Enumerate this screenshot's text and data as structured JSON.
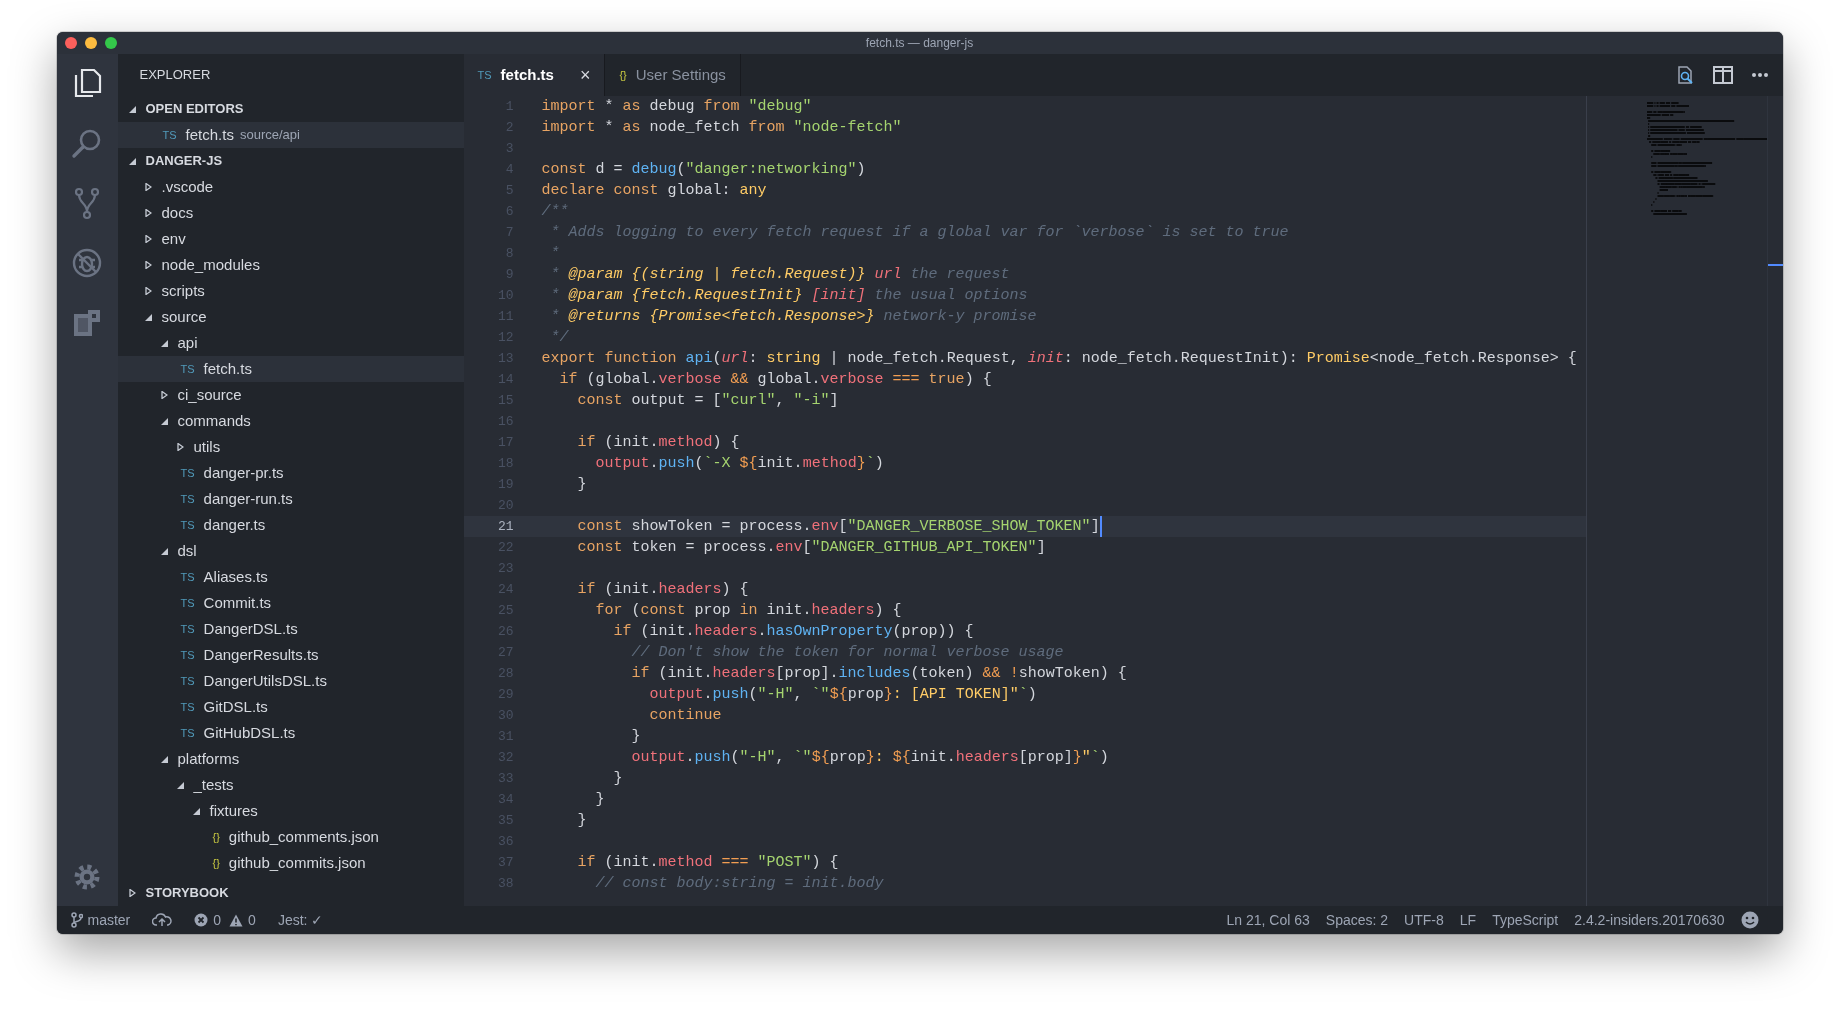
{
  "window": {
    "title": "fetch.ts — danger-js"
  },
  "activity_bar": {
    "items": [
      {
        "kind": "files",
        "selected": true
      },
      {
        "kind": "search",
        "selected": false
      },
      {
        "kind": "git",
        "selected": false
      },
      {
        "kind": "debug",
        "selected": false
      },
      {
        "kind": "extensions",
        "selected": false
      }
    ],
    "bottom": [
      {
        "kind": "settings",
        "selected": false
      }
    ]
  },
  "sidebar": {
    "title": "EXPLORER",
    "sections": [
      {
        "title": "OPEN EDITORS",
        "expanded": true,
        "items": [
          {
            "label": "fetch.ts",
            "path": "source/api",
            "kind": "ts",
            "badge": "TS",
            "selected": true
          }
        ]
      },
      {
        "title": "DANGER-JS",
        "expanded": true,
        "items": [
          {
            "label": ".vscode",
            "kind": "folder",
            "expanded": false,
            "selected": false
          },
          {
            "label": "docs",
            "kind": "folder",
            "expanded": false,
            "selected": false
          },
          {
            "label": "env",
            "kind": "folder",
            "expanded": false,
            "selected": false
          },
          {
            "label": "node_modules",
            "kind": "folder",
            "expanded": false,
            "selected": false
          },
          {
            "label": "scripts",
            "kind": "folder",
            "expanded": false,
            "selected": false
          },
          {
            "label": "source",
            "kind": "folder",
            "expanded": true,
            "selected": false,
            "children": [
              {
                "label": "api",
                "kind": "folder",
                "expanded": true,
                "selected": false,
                "children": [
                  {
                    "label": "fetch.ts",
                    "kind": "ts",
                    "badge": "TS",
                    "selected": true
                  }
                ]
              },
              {
                "label": "ci_source",
                "kind": "folder",
                "expanded": false,
                "selected": false
              },
              {
                "label": "commands",
                "kind": "folder",
                "expanded": true,
                "selected": false,
                "children": [
                  {
                    "label": "utils",
                    "kind": "folder",
                    "expanded": false,
                    "selected": false
                  },
                  {
                    "label": "danger-pr.ts",
                    "kind": "ts",
                    "badge": "TS",
                    "selected": false
                  },
                  {
                    "label": "danger-run.ts",
                    "kind": "ts",
                    "badge": "TS",
                    "selected": false
                  },
                  {
                    "label": "danger.ts",
                    "kind": "ts",
                    "badge": "TS",
                    "selected": false
                  }
                ]
              },
              {
                "label": "dsl",
                "kind": "folder",
                "expanded": true,
                "selected": false,
                "children": [
                  {
                    "label": "Aliases.ts",
                    "kind": "ts",
                    "badge": "TS",
                    "selected": false
                  },
                  {
                    "label": "Commit.ts",
                    "kind": "ts",
                    "badge": "TS",
                    "selected": false
                  },
                  {
                    "label": "DangerDSL.ts",
                    "kind": "ts",
                    "badge": "TS",
                    "selected": false
                  },
                  {
                    "label": "DangerResults.ts",
                    "kind": "ts",
                    "badge": "TS",
                    "selected": false
                  },
                  {
                    "label": "DangerUtilsDSL.ts",
                    "kind": "ts",
                    "badge": "TS",
                    "selected": false
                  },
                  {
                    "label": "GitDSL.ts",
                    "kind": "ts",
                    "badge": "TS",
                    "selected": false
                  },
                  {
                    "label": "GitHubDSL.ts",
                    "kind": "ts",
                    "badge": "TS",
                    "selected": false
                  }
                ]
              },
              {
                "label": "platforms",
                "kind": "folder",
                "expanded": true,
                "selected": false,
                "children": [
                  {
                    "label": "_tests",
                    "kind": "folder",
                    "expanded": true,
                    "selected": false,
                    "children": [
                      {
                        "label": "fixtures",
                        "kind": "folder",
                        "expanded": true,
                        "selected": false,
                        "children": [
                          {
                            "label": "github_comments.json",
                            "kind": "json",
                            "badge": "{}",
                            "selected": false
                          },
                          {
                            "label": "github_commits.json",
                            "kind": "json",
                            "badge": "{}",
                            "selected": false
                          }
                        ]
                      }
                    ]
                  }
                ]
              }
            ]
          }
        ]
      },
      {
        "title": "STORYBOOK",
        "expanded": false
      }
    ]
  },
  "editor": {
    "tabs": [
      {
        "label": "fetch.ts",
        "kind": "ts",
        "badge": "TS",
        "selected": true,
        "close": "×"
      },
      {
        "label": "User Settings",
        "kind": "json",
        "badge": "{}",
        "selected": false
      }
    ],
    "lines": [
      {
        "number": "1",
        "current": false,
        "tokens": [
          {
            "kind": "keyword",
            "text": "import"
          },
          {
            "kind": "plain",
            "text": " * "
          },
          {
            "kind": "keyword",
            "text": "as"
          },
          {
            "kind": "plain",
            "text": " debug "
          },
          {
            "kind": "keyword",
            "text": "from"
          },
          {
            "kind": "string",
            "text": " \"debug\""
          }
        ]
      },
      {
        "number": "2",
        "current": false,
        "tokens": [
          {
            "kind": "keyword",
            "text": "import"
          },
          {
            "kind": "plain",
            "text": " * "
          },
          {
            "kind": "keyword",
            "text": "as"
          },
          {
            "kind": "plain",
            "text": " node_fetch "
          },
          {
            "kind": "keyword",
            "text": "from"
          },
          {
            "kind": "string",
            "text": " \"node-fetch\""
          }
        ]
      },
      {
        "number": "3",
        "current": false
      },
      {
        "number": "4",
        "current": false,
        "tokens": [
          {
            "kind": "keyword",
            "text": "const"
          },
          {
            "kind": "plain",
            "text": " d = "
          },
          {
            "kind": "function",
            "text": "debug"
          },
          {
            "kind": "plain",
            "text": "("
          },
          {
            "kind": "string",
            "text": "\"danger:networking\""
          },
          {
            "kind": "plain",
            "text": ")"
          }
        ]
      },
      {
        "number": "5",
        "current": false,
        "tokens": [
          {
            "kind": "keyword",
            "text": "declare const"
          },
          {
            "kind": "plain",
            "text": " global: "
          },
          {
            "kind": "type",
            "text": "any"
          }
        ]
      },
      {
        "number": "6",
        "current": false,
        "tokens": [
          {
            "kind": "comment",
            "text": "/**"
          }
        ]
      },
      {
        "number": "7",
        "current": false,
        "tokens": [
          {
            "kind": "comment",
            "text": " * Adds logging to every fetch request if a global var for `verbose` is set to true"
          }
        ]
      },
      {
        "number": "8",
        "current": false,
        "tokens": [
          {
            "kind": "comment",
            "text": " *"
          }
        ]
      },
      {
        "number": "9",
        "current": false,
        "tokens": [
          {
            "kind": "comment",
            "text": " * "
          },
          {
            "kind": "doctag",
            "text": "@param {(string | fetch.Request)}"
          },
          {
            "kind": "param",
            "text": " url"
          },
          {
            "kind": "comment",
            "text": " the request"
          }
        ]
      },
      {
        "number": "10",
        "current": false,
        "tokens": [
          {
            "kind": "comment",
            "text": " * "
          },
          {
            "kind": "doctag",
            "text": "@param {fetch.RequestInit}"
          },
          {
            "kind": "param",
            "text": " [init]"
          },
          {
            "kind": "comment",
            "text": " the usual options"
          }
        ]
      },
      {
        "number": "11",
        "current": false,
        "tokens": [
          {
            "kind": "comment",
            "text": " * "
          },
          {
            "kind": "doctag",
            "text": "@returns {Promise<fetch.Response>}"
          },
          {
            "kind": "comment",
            "text": " network-y promise"
          }
        ]
      },
      {
        "number": "12",
        "current": false,
        "tokens": [
          {
            "kind": "comment",
            "text": " */"
          }
        ]
      },
      {
        "number": "13",
        "current": false,
        "tokens": [
          {
            "kind": "keyword",
            "text": "export function"
          },
          {
            "kind": "function",
            "text": " api"
          },
          {
            "kind": "plain",
            "text": "("
          },
          {
            "kind": "param",
            "text": "url"
          },
          {
            "kind": "plain",
            "text": ": "
          },
          {
            "kind": "type",
            "text": "string"
          },
          {
            "kind": "plain",
            "text": " | node_fetch.Request, "
          },
          {
            "kind": "param",
            "text": "init"
          },
          {
            "kind": "plain",
            "text": ": node_fetch.RequestInit): "
          },
          {
            "kind": "type",
            "text": "Promise"
          },
          {
            "kind": "plain",
            "text": "<node_fetch.Response> {"
          }
        ]
      },
      {
        "number": "14",
        "current": false,
        "tokens": [
          {
            "kind": "keyword",
            "text": "  if"
          },
          {
            "kind": "plain",
            "text": " (global."
          },
          {
            "kind": "property",
            "text": "verbose"
          },
          {
            "kind": "operator",
            "text": " &&"
          },
          {
            "kind": "plain",
            "text": " global."
          },
          {
            "kind": "property",
            "text": "verbose"
          },
          {
            "kind": "operator",
            "text": " ==="
          },
          {
            "kind": "keyword",
            "text": " true"
          },
          {
            "kind": "plain",
            "text": ") {"
          }
        ]
      },
      {
        "number": "15",
        "current": false,
        "tokens": [
          {
            "kind": "keyword",
            "text": "    const"
          },
          {
            "kind": "plain",
            "text": " output = ["
          },
          {
            "kind": "string",
            "text": "\"curl\""
          },
          {
            "kind": "plain",
            "text": ", "
          },
          {
            "kind": "string",
            "text": "\"-i\""
          },
          {
            "kind": "plain",
            "text": "]"
          }
        ]
      },
      {
        "number": "16",
        "current": false
      },
      {
        "number": "17",
        "current": false,
        "tokens": [
          {
            "kind": "keyword",
            "text": "    if"
          },
          {
            "kind": "plain",
            "text": " (init."
          },
          {
            "kind": "property",
            "text": "method"
          },
          {
            "kind": "plain",
            "text": ") {"
          }
        ]
      },
      {
        "number": "18",
        "current": false,
        "tokens": [
          {
            "kind": "property",
            "text": "      output"
          },
          {
            "kind": "plain",
            "text": "."
          },
          {
            "kind": "function",
            "text": "push"
          },
          {
            "kind": "plain",
            "text": "("
          },
          {
            "kind": "string",
            "text": "`-X "
          },
          {
            "kind": "operator",
            "text": "${"
          },
          {
            "kind": "plain",
            "text": "init."
          },
          {
            "kind": "property",
            "text": "method"
          },
          {
            "kind": "operator",
            "text": "}"
          },
          {
            "kind": "string",
            "text": "`"
          },
          {
            "kind": "plain",
            "text": ")"
          }
        ]
      },
      {
        "number": "19",
        "current": false,
        "tokens": [
          {
            "kind": "plain",
            "text": "    }"
          }
        ]
      },
      {
        "number": "20",
        "current": false
      },
      {
        "number": "21",
        "current": true,
        "tokens": [
          {
            "kind": "keyword",
            "text": "    const"
          },
          {
            "kind": "plain",
            "text": " showToken = process."
          },
          {
            "kind": "property",
            "text": "env"
          },
          {
            "kind": "plain",
            "text": "["
          },
          {
            "kind": "string",
            "text": "\"DANGER_VERBOSE_SHOW_TOKEN\""
          },
          {
            "kind": "plain",
            "text": "]"
          }
        ]
      },
      {
        "number": "22",
        "current": false,
        "tokens": [
          {
            "kind": "keyword",
            "text": "    const"
          },
          {
            "kind": "plain",
            "text": " token = process."
          },
          {
            "kind": "property",
            "text": "env"
          },
          {
            "kind": "plain",
            "text": "["
          },
          {
            "kind": "string",
            "text": "\"DANGER_GITHUB_API_TOKEN\""
          },
          {
            "kind": "plain",
            "text": "]"
          }
        ]
      },
      {
        "number": "23",
        "current": false
      },
      {
        "number": "24",
        "current": false,
        "tokens": [
          {
            "kind": "keyword",
            "text": "    if"
          },
          {
            "kind": "plain",
            "text": " (init."
          },
          {
            "kind": "property",
            "text": "headers"
          },
          {
            "kind": "plain",
            "text": ") {"
          }
        ]
      },
      {
        "number": "25",
        "current": false,
        "tokens": [
          {
            "kind": "keyword",
            "text": "      for"
          },
          {
            "kind": "plain",
            "text": " ("
          },
          {
            "kind": "keyword",
            "text": "const"
          },
          {
            "kind": "plain",
            "text": " prop "
          },
          {
            "kind": "keyword",
            "text": "in"
          },
          {
            "kind": "plain",
            "text": " init."
          },
          {
            "kind": "property",
            "text": "headers"
          },
          {
            "kind": "plain",
            "text": ") {"
          }
        ]
      },
      {
        "number": "26",
        "current": false,
        "tokens": [
          {
            "kind": "keyword",
            "text": "        if"
          },
          {
            "kind": "plain",
            "text": " (init."
          },
          {
            "kind": "property",
            "text": "headers"
          },
          {
            "kind": "plain",
            "text": "."
          },
          {
            "kind": "function",
            "text": "hasOwnProperty"
          },
          {
            "kind": "plain",
            "text": "(prop)) {"
          }
        ]
      },
      {
        "number": "27",
        "current": false,
        "tokens": [
          {
            "kind": "comment",
            "text": "          // Don't show the token for normal verbose usage"
          }
        ]
      },
      {
        "number": "28",
        "current": false,
        "tokens": [
          {
            "kind": "keyword",
            "text": "          if"
          },
          {
            "kind": "plain",
            "text": " (init."
          },
          {
            "kind": "property",
            "text": "headers"
          },
          {
            "kind": "plain",
            "text": "[prop]."
          },
          {
            "kind": "function",
            "text": "includes"
          },
          {
            "kind": "plain",
            "text": "(token) "
          },
          {
            "kind": "operator",
            "text": "&&"
          },
          {
            "kind": "operator",
            "text": " !"
          },
          {
            "kind": "plain",
            "text": "showToken) {"
          }
        ]
      },
      {
        "number": "29",
        "current": false,
        "tokens": [
          {
            "kind": "property",
            "text": "            output"
          },
          {
            "kind": "plain",
            "text": "."
          },
          {
            "kind": "function",
            "text": "push"
          },
          {
            "kind": "plain",
            "text": "("
          },
          {
            "kind": "string",
            "text": "\"-H\""
          },
          {
            "kind": "plain",
            "text": ", "
          },
          {
            "kind": "string",
            "text": "`\""
          },
          {
            "kind": "operator",
            "text": "${"
          },
          {
            "kind": "plain",
            "text": "prop"
          },
          {
            "kind": "operator",
            "text": "}"
          },
          {
            "kind": "type",
            "text": ": [API TOKEN]\""
          },
          {
            "kind": "string",
            "text": "`"
          },
          {
            "kind": "plain",
            "text": ")"
          }
        ]
      },
      {
        "number": "30",
        "current": false,
        "tokens": [
          {
            "kind": "keyword",
            "text": "            continue"
          }
        ]
      },
      {
        "number": "31",
        "current": false,
        "tokens": [
          {
            "kind": "plain",
            "text": "          }"
          }
        ]
      },
      {
        "number": "32",
        "current": false,
        "tokens": [
          {
            "kind": "property",
            "text": "          output"
          },
          {
            "kind": "plain",
            "text": "."
          },
          {
            "kind": "function",
            "text": "push"
          },
          {
            "kind": "plain",
            "text": "("
          },
          {
            "kind": "string",
            "text": "\"-H\""
          },
          {
            "kind": "plain",
            "text": ", "
          },
          {
            "kind": "string",
            "text": "`\""
          },
          {
            "kind": "operator",
            "text": "${"
          },
          {
            "kind": "plain",
            "text": "prop"
          },
          {
            "kind": "operator",
            "text": "}"
          },
          {
            "kind": "type",
            "text": ": "
          },
          {
            "kind": "operator",
            "text": "${"
          },
          {
            "kind": "plain",
            "text": "init."
          },
          {
            "kind": "property",
            "text": "headers"
          },
          {
            "kind": "plain",
            "text": "[prop]"
          },
          {
            "kind": "operator",
            "text": "}"
          },
          {
            "kind": "type",
            "text": "\""
          },
          {
            "kind": "string",
            "text": "`"
          },
          {
            "kind": "plain",
            "text": ")"
          }
        ]
      },
      {
        "number": "33",
        "current": false,
        "tokens": [
          {
            "kind": "plain",
            "text": "        }"
          }
        ]
      },
      {
        "number": "34",
        "current": false,
        "tokens": [
          {
            "kind": "plain",
            "text": "      }"
          }
        ]
      },
      {
        "number": "35",
        "current": false,
        "tokens": [
          {
            "kind": "plain",
            "text": "    }"
          }
        ]
      },
      {
        "number": "36",
        "current": false
      },
      {
        "number": "37",
        "current": false,
        "tokens": [
          {
            "kind": "keyword",
            "text": "    if"
          },
          {
            "kind": "plain",
            "text": " (init."
          },
          {
            "kind": "property",
            "text": "method"
          },
          {
            "kind": "operator",
            "text": " ==="
          },
          {
            "kind": "string",
            "text": " \"POST\""
          },
          {
            "kind": "plain",
            "text": ") {"
          }
        ]
      },
      {
        "number": "38",
        "current": false,
        "tokens": [
          {
            "kind": "comment",
            "text": "      // const body:string = init.body"
          }
        ]
      }
    ]
  },
  "status_bar": {
    "left": [
      {
        "kind": "branch",
        "text": "master"
      },
      {
        "kind": "sync"
      },
      {
        "kind": "errors",
        "text": "0"
      },
      {
        "kind": "warnings",
        "text": "0"
      },
      {
        "kind": "plain",
        "text": "Jest: ✓"
      }
    ],
    "right": [
      {
        "kind": "plain",
        "text": "Ln 21, Col 63"
      },
      {
        "kind": "plain",
        "text": "Spaces: 2"
      },
      {
        "kind": "plain",
        "text": "UTF-8"
      },
      {
        "kind": "plain",
        "text": "LF"
      },
      {
        "kind": "plain",
        "text": "TypeScript"
      },
      {
        "kind": "plain",
        "text": "2.4.2-insiders.20170630"
      },
      {
        "kind": "feedback"
      }
    ]
  }
}
